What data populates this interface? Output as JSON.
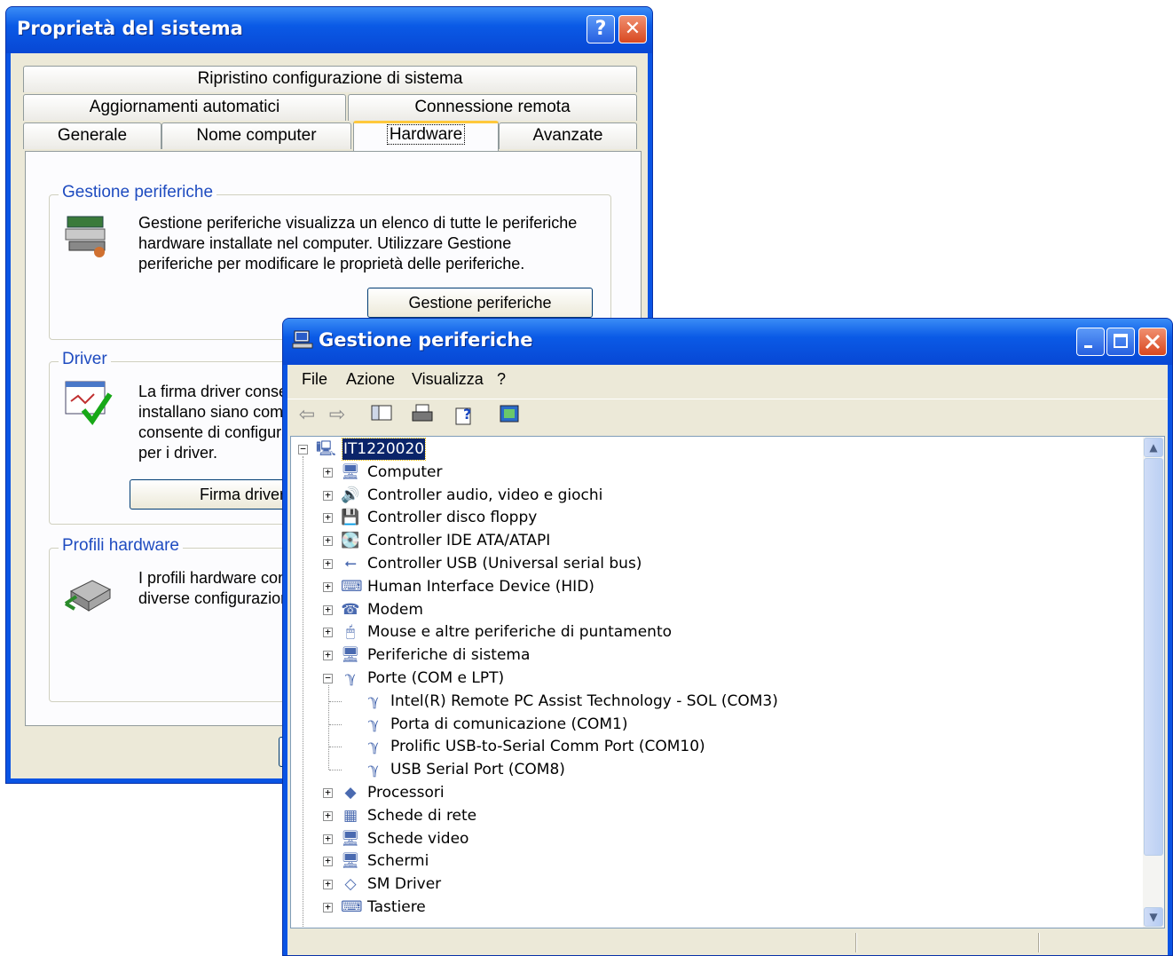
{
  "system_properties": {
    "title": "Proprietà del sistema",
    "help_glyph": "?",
    "close_glyph": "✕",
    "tabs_row1": [
      "Ripristino configurazione di sistema"
    ],
    "tabs_row2": [
      "Aggiornamenti automatici",
      "Connessione remota"
    ],
    "tabs_row3": [
      "Generale",
      "Nome computer",
      "Hardware",
      "Avanzate"
    ],
    "active_tab": "Hardware",
    "device_manager_group": {
      "title": "Gestione periferiche",
      "line1": "Gestione periferiche visualizza un elenco di tutte le periferiche",
      "line2": "hardware installate nel computer. Utilizzare Gestione",
      "line3": "periferiche per modificare le proprietà delle periferiche.",
      "button": "Gestione periferiche"
    },
    "driver_group": {
      "title": "Driver",
      "line1": "La firma driver conse",
      "line2": "installano siano comp",
      "line3": "consente di configura",
      "line4": "per i driver.",
      "button": "Firma driver"
    },
    "profiles_group": {
      "title": "Profili hardware",
      "line1": "I profili hardware con",
      "line2": "diverse configurazior"
    }
  },
  "device_manager": {
    "title": "Gestione periferiche",
    "menu": [
      "File",
      "Azione",
      "Visualizza",
      "?"
    ],
    "toolbar_icons": [
      "back-arrow-icon",
      "forward-arrow-icon",
      "show-hide-tree-icon",
      "print-icon",
      "properties-help-icon",
      "update-driver-icon"
    ],
    "root": "IT1220020",
    "categories": [
      "Computer",
      "Controller audio, video e giochi",
      "Controller disco floppy",
      "Controller IDE ATA/ATAPI",
      "Controller USB (Universal serial bus)",
      "Human Interface Device (HID)",
      "Modem",
      "Mouse e altre periferiche di puntamento",
      "Periferiche di sistema",
      "Porte (COM e LPT)"
    ],
    "ports_children": [
      "Intel(R) Remote PC Assist Technology - SOL (COM3)",
      "Porta di comunicazione (COM1)",
      "Prolific USB-to-Serial Comm Port (COM10)",
      "USB Serial Port (COM8)"
    ],
    "categories_after": [
      "Processori",
      "Schede di rete",
      "Schede video",
      "Schermi",
      "SM Driver",
      "Tastiere"
    ],
    "expand_plus": "+",
    "expand_minus": "−"
  }
}
